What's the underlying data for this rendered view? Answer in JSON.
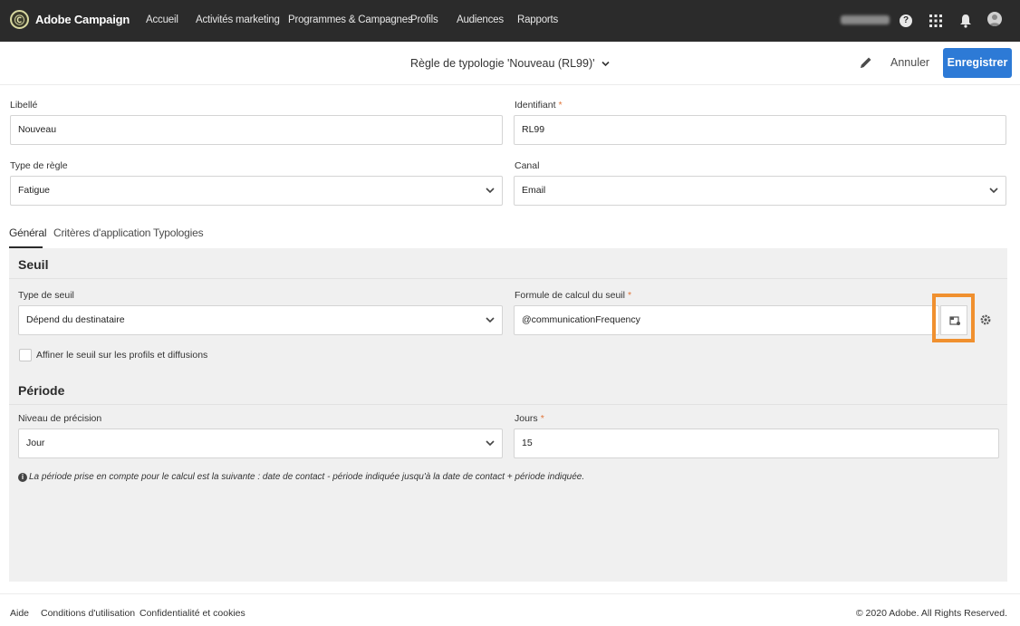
{
  "topbar": {
    "brand_name": "Adobe Campaign",
    "nav": [
      "Accueil",
      "Activités marketing",
      "Programmes & Campagnes",
      "Profils",
      "Audiences",
      "Rapports"
    ],
    "help_glyph": "?"
  },
  "header": {
    "title": "Règle de typologie 'Nouveau (RL99)'",
    "cancel_label": "Annuler",
    "save_label": "Enregistrer"
  },
  "form": {
    "libelle_label": "Libellé",
    "libelle_value": "Nouveau",
    "identifiant_label": "Identifiant",
    "identifiant_value": "RL99",
    "type_regle_label": "Type de règle",
    "type_regle_value": "Fatigue",
    "canal_label": "Canal",
    "canal_value": "Email",
    "required_mark": "*"
  },
  "tabs": [
    "Général",
    "Critères d'application",
    "Typologies"
  ],
  "seuil": {
    "title": "Seuil",
    "type_label": "Type de seuil",
    "type_value": "Dépend du destinataire",
    "formule_label": "Formule de calcul du seuil",
    "formule_value": "@communicationFrequency",
    "checkbox_label": "Affiner le seuil sur les profils et diffusions"
  },
  "periode": {
    "title": "Période",
    "niveau_label": "Niveau de précision",
    "niveau_value": "Jour",
    "jours_label": "Jours",
    "jours_value": "15",
    "info_glyph": "i",
    "info_text": "La période prise en compte pour le calcul est la suivante : date de contact - période indiquée jusqu'à la date de contact + période indiquée."
  },
  "footer": {
    "links": [
      "Aide",
      "Conditions d'utilisation",
      "Confidentialité et cookies"
    ],
    "copyright": "© 2020 Adobe. All Rights Reserved."
  },
  "colors": {
    "topbar": "#2b2b2b",
    "primary_button": "#2d7ad6",
    "highlight": "#f0902f",
    "required": "#e0763a"
  }
}
